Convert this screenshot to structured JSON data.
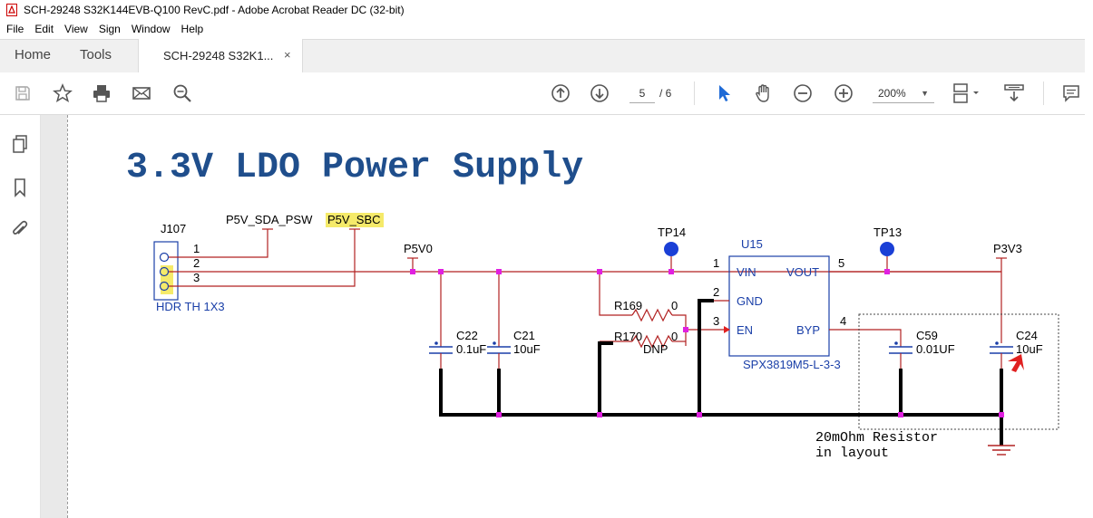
{
  "window": {
    "title": "SCH-29248 S32K144EVB-Q100 RevC.pdf - Adobe Acrobat Reader DC (32-bit)"
  },
  "menu": [
    "File",
    "Edit",
    "View",
    "Sign",
    "Window",
    "Help"
  ],
  "tabs": {
    "home": "Home",
    "tools": "Tools",
    "document": "SCH-29248 S32K1...",
    "close": "×"
  },
  "toolbar": {
    "page_current": "5",
    "page_total": "/ 6",
    "zoom": "200%",
    "icons": [
      "save-icon",
      "bookmark-star-icon",
      "print-icon",
      "email-icon",
      "find-icon",
      "prev-page-icon",
      "next-page-icon",
      "select-pointer-icon",
      "hand-tool-icon",
      "zoom-out-icon",
      "zoom-in-icon",
      "page-display-icon",
      "scroll-mode-icon",
      "comment-icon"
    ]
  },
  "leftrail": {
    "icons": [
      "thumbnails-icon",
      "bookmarks-icon",
      "attachments-icon"
    ]
  },
  "schematic": {
    "title": "3.3V LDO Power Supply",
    "connector": {
      "ref": "J107",
      "part": "HDR TH 1X3",
      "pins": [
        "1",
        "2",
        "3"
      ]
    },
    "nets": {
      "p5v_sda_psw": "P5V_SDA_PSW",
      "p5v_sbc": "P5V_SBC",
      "p5v0": "P5V0",
      "p3v3": "P3V3"
    },
    "testpoints": [
      "TP14",
      "TP13"
    ],
    "regulator": {
      "ref": "U15",
      "part": "SPX3819M5-L-3-3",
      "pins": {
        "vin": "VIN",
        "gnd": "GND",
        "en": "EN",
        "vout": "VOUT",
        "byp": "BYP"
      },
      "pin_numbers": {
        "vin": "1",
        "gnd": "2",
        "en": "3",
        "byp": "4",
        "vout": "5"
      }
    },
    "resistors": [
      {
        "ref": "R169",
        "value": "0"
      },
      {
        "ref": "R170",
        "value": "0",
        "note": "DNP"
      }
    ],
    "capacitors": [
      {
        "ref": "C22",
        "value": "0.1uF"
      },
      {
        "ref": "C21",
        "value": "10uF"
      },
      {
        "ref": "C59",
        "value": "0.01UF"
      },
      {
        "ref": "C24",
        "value": "10uF"
      }
    ],
    "note_line1": "20mOhm Resistor",
    "note_line2": "in layout",
    "colors": {
      "title": "#1f4e8c",
      "wire": "#b22222",
      "junction": "#e020e0",
      "tp": "#1a3fd6",
      "part": "#1a3fa8",
      "highlight": "#f5ea6a",
      "gnd_bus": "#000000",
      "arrow": "#e02020"
    }
  }
}
